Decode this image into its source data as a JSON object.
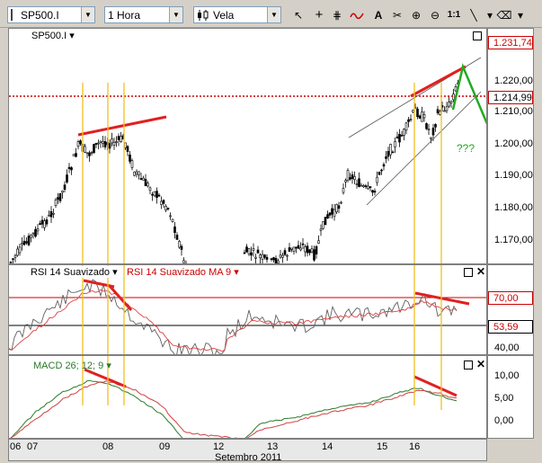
{
  "toolbar": {
    "symbol": "SP500.I",
    "period": "1 Hora",
    "chart_style": "Vela",
    "zoom_label": "1:1",
    "icons": [
      "cursor-icon",
      "crosshair-icon",
      "grid-icon",
      "indicators-icon",
      "text-icon",
      "cut-icon",
      "zoom-in-icon",
      "zoom-out-icon",
      "line-tool-icon",
      "eraser-icon"
    ]
  },
  "price_pane": {
    "symbol_label": "SP500.I ▾",
    "scale_ticks": [
      "1.220,00",
      "1.210,00",
      "1.200,00",
      "1.190,00",
      "1.180,00",
      "1.170,00"
    ],
    "top_price": "1.231,74",
    "current_price": "1.214,99",
    "annotation": "???"
  },
  "rsi_pane": {
    "label": "RSI 14 Suavizado ▾",
    "ma_label": "RSI 14 Suavizado MA 9 ▾",
    "scale_ticks": [
      "40,00"
    ],
    "level_high": "70,00",
    "current_value": "53,59"
  },
  "macd_pane": {
    "label": "MACD 26; 12; 9 ▾",
    "scale_ticks": [
      "10,00",
      "5,00",
      "0,00"
    ]
  },
  "x_axis": {
    "labels": [
      "06",
      "07",
      "08",
      "09",
      "12",
      "13",
      "14",
      "15",
      "16"
    ],
    "month": "Setembro 2011"
  },
  "colors": {
    "price_line": "#cc0000",
    "trend_red": "#e02020",
    "trend_green": "#22aa22",
    "fib_line": "#f0c020",
    "rsi_line": "#606060",
    "ma_line": "#e04040",
    "macd_line": "#2a7a2a"
  }
}
